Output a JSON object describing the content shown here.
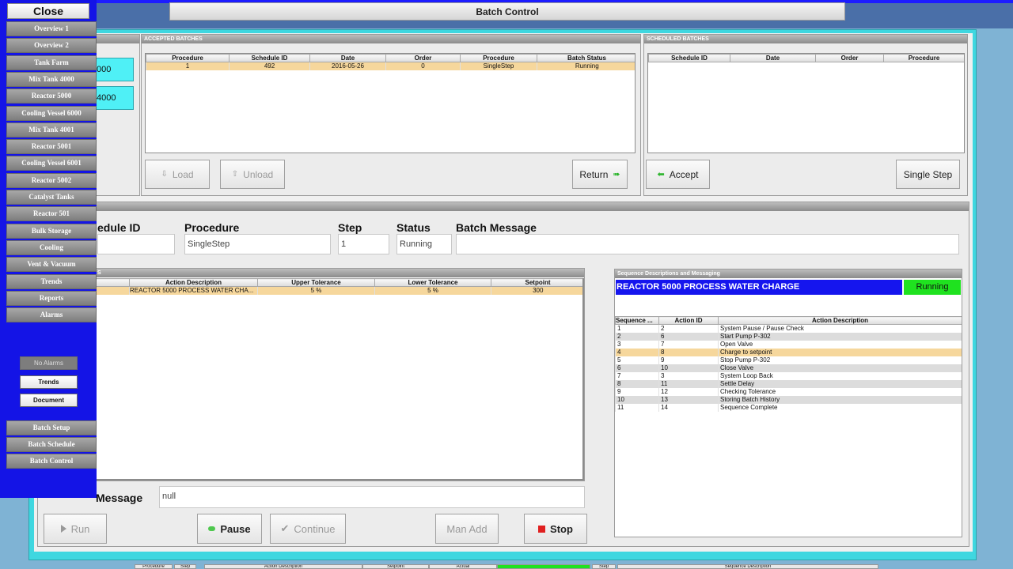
{
  "window": {
    "title": "Batch Control"
  },
  "nav": {
    "close_label": "Close",
    "items": [
      "Overview 1",
      "Overview 2",
      "Tank Farm",
      "Mix Tank 4000",
      "Reactor 5000",
      "Cooling Vessel 6000",
      "Mix Tank 4001",
      "Reactor 5001",
      "Cooling Vessel 6001",
      "Reactor 5002",
      "Catalyst Tanks",
      "Reactor 501",
      "Bulk Storage",
      "Cooling",
      "Vent & Vacuum",
      "Trends",
      "Reports",
      "Alarms"
    ],
    "no_alarms": "No Alarms",
    "trends_btn": "Trends",
    "document_btn": "Document",
    "batch_items": [
      "Batch Setup",
      "Batch Schedule",
      "Batch Control"
    ]
  },
  "left_chips": [
    "000",
    "4000"
  ],
  "accepted": {
    "header": "Accepted Batches",
    "columns": [
      "Procedure",
      "Schedule ID",
      "Date",
      "Order",
      "Procedure",
      "Batch Status"
    ],
    "rows": [
      [
        "1",
        "492",
        "2016-05-26",
        "0",
        "SingleStep",
        "Running"
      ]
    ],
    "load_label": "Load",
    "unload_label": "Unload",
    "return_label": "Return"
  },
  "scheduled": {
    "header": "Scheduled Batches",
    "columns": [
      "Schedule ID",
      "Date",
      "Order",
      "Procedure"
    ],
    "accept_label": "Accept",
    "single_step_label": "Single Step"
  },
  "detail": {
    "schedule_id_label": "edule ID",
    "procedure_label": "Procedure",
    "procedure_value": "SingleStep",
    "step_label": "Step",
    "step_value": "1",
    "status_label": "Status",
    "status_value": "Running",
    "batch_message_label": "Batch Message",
    "batch_message_value": ""
  },
  "actions": {
    "header": "s",
    "columns": [
      "Action Description",
      "Upper Tolerance",
      "Lower Tolerance",
      "Setpoint"
    ],
    "rows": [
      [
        "REACTOR 5000 PROCESS WATER CHA...",
        "5 %",
        "5 %",
        "300"
      ]
    ]
  },
  "sequence": {
    "header": "Sequence Descriptions and Messaging",
    "title": "REACTOR 5000 PROCESS WATER CHARGE",
    "status": "Running",
    "columns": [
      "Sequence ...",
      "Action ID",
      "Action Description"
    ],
    "rows": [
      [
        "1",
        "2",
        "System Pause / Pause Check"
      ],
      [
        "2",
        "6",
        "Start Pump P-302"
      ],
      [
        "3",
        "7",
        "Open Valve"
      ],
      [
        "4",
        "8",
        "Charge to setpoint"
      ],
      [
        "5",
        "9",
        "Stop Pump P-302"
      ],
      [
        "6",
        "10",
        "Close Valve"
      ],
      [
        "7",
        "3",
        "System Loop Back"
      ],
      [
        "8",
        "11",
        "Settle Delay"
      ],
      [
        "9",
        "12",
        "Checking Tolerance"
      ],
      [
        "10",
        "13",
        "Storing Batch History"
      ],
      [
        "11",
        "14",
        "Sequence Complete"
      ]
    ],
    "selected_index": 3
  },
  "operator": {
    "label": "Message",
    "value": "null"
  },
  "controls": {
    "run_label": "Run",
    "pause_label": "Pause",
    "continue_label": "Continue",
    "man_add_label": "Man Add",
    "stop_label": "Stop"
  },
  "bottom_strip": [
    "Procedure",
    "Step",
    "Action Description",
    "Setpoint",
    "Actual",
    "Step",
    "Sequence Description"
  ]
}
